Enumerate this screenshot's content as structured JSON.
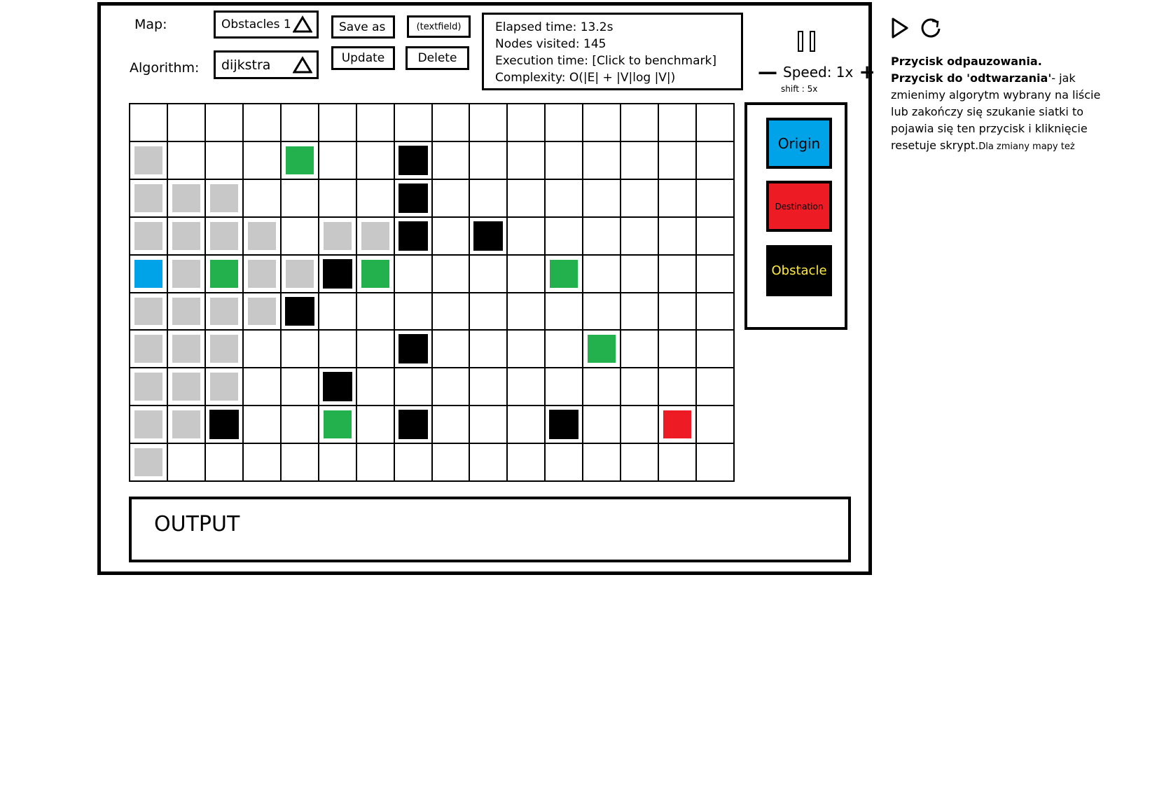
{
  "map": {
    "label": "Map:",
    "value": "Obstacles 1"
  },
  "algorithm": {
    "label": "Algorithm:",
    "value": "dijkstra"
  },
  "buttons": {
    "save_as": "Save as",
    "update": "Update",
    "delete": "Delete",
    "textfield": "(textfield)"
  },
  "stats": {
    "elapsed": "Elapsed time: 13.2s",
    "nodes": "Nodes visited: 145",
    "execution": "Execution time: [Click to benchmark]",
    "complexity": "Complexity: O(|E| + |V|log |V|)"
  },
  "speed": {
    "minus": "—",
    "label": "Speed: 1x",
    "plus": "+",
    "shift": "shift : 5x"
  },
  "legend": {
    "origin": "Origin",
    "destination": "Destination",
    "obstacle": "Obstacle"
  },
  "output": {
    "label": "OUTPUT"
  },
  "notes": {
    "line1_bold": "Przycisk odpauzowania.",
    "line2_bold": "Przycisk do 'odtwarzania'",
    "line2_rest": "- jak zmienimy algorytm wybrany na liście lub zakończy się szukanie siatki to pojawia się ten przycisk i kliknięcie resetuje skrypt.",
    "line2_small": "Dla zmiany mapy też"
  },
  "grid": {
    "cols": 16,
    "rows": [
      "................",
      "v...g..k........",
      "vvv....k........",
      "vvvv.vvk.k......",
      "ovgvvkg....g....",
      "vvvvk...........",
      "vvv....k....g...",
      "vvv..k..........",
      "vvk..g.k...k..r.",
      "v..............."
    ]
  },
  "colors": {
    "origin": "#00a2e8",
    "destination": "#ed1c24",
    "obstacle": "#000000",
    "path": "#22b14c",
    "visited": "#c8c8c8",
    "obstacle_text": "#ffeb3b"
  }
}
